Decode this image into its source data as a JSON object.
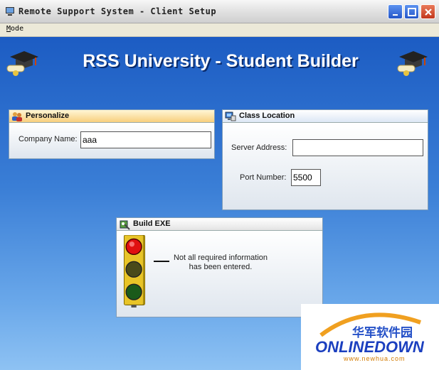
{
  "window": {
    "title": "Remote Support System - Client Setup"
  },
  "menu": {
    "items": [
      "Mode"
    ]
  },
  "header": {
    "title": "RSS University - Student Builder"
  },
  "personalize": {
    "title": "Personalize",
    "company_label": "Company Name:",
    "company_value": "aaa"
  },
  "class_location": {
    "title": "Class Location",
    "server_label": "Server Address:",
    "server_value": "",
    "port_label": "Port Number:",
    "port_value": "5500"
  },
  "build": {
    "title": "Build EXE",
    "status_line1": "Not all required information",
    "status_line2": "has been entered.",
    "traffic_light_state": "red"
  },
  "watermark": {
    "cn_text": "华军软件园",
    "logo": "ONLINEDOWN",
    "url": "www.newhua.com"
  },
  "colors": {
    "background_top": "#1c5cc3",
    "background_bottom": "#8ec2f3",
    "personalize_header": "#f8cf7d",
    "traffic_red": "#e01010"
  }
}
